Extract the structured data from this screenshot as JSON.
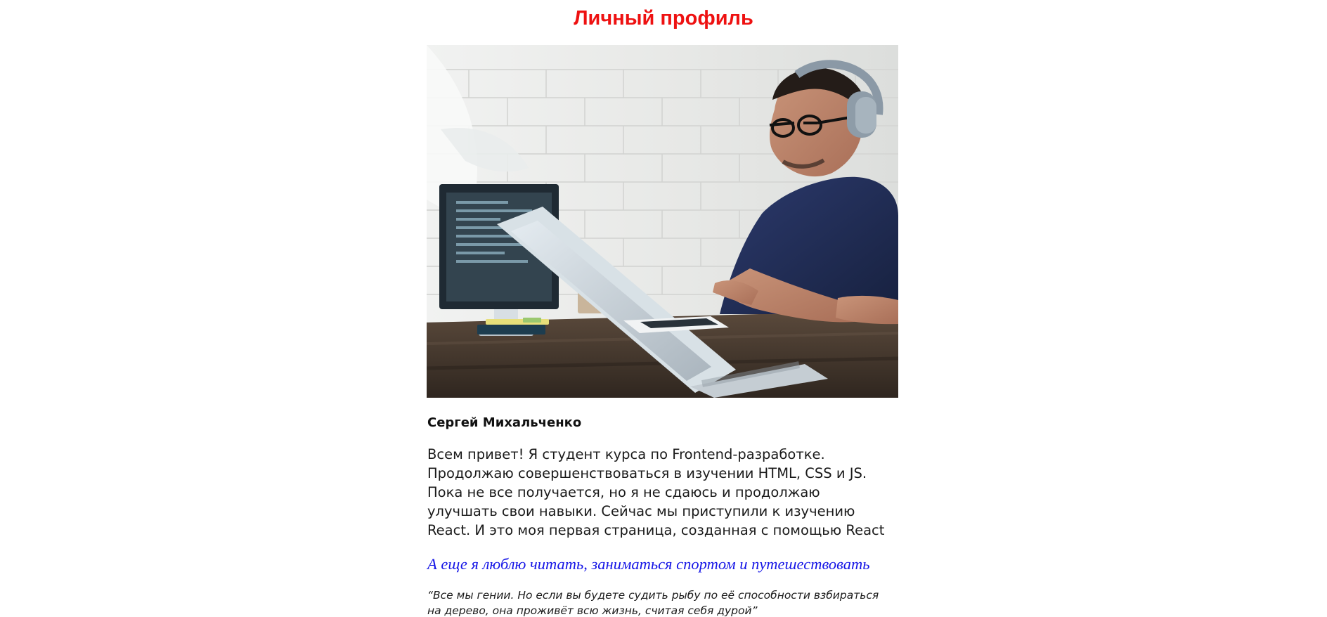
{
  "colors": {
    "title": "#ee1111",
    "hobby": "#1515e6"
  },
  "profile": {
    "title": "Личный профиль",
    "photo_description": "developer-at-computer-photo",
    "name": "Сергей Михальченко",
    "bio": "Всем привет! Я студент курса по Frontend-разработке. Продолжаю совершенствоваться в изучении HTML, CSS и JS. Пока не все получается, но я не сдаюсь и продолжаю улучшать свои навыки. Сейчас мы приступили к изучению React. И это моя первая страница, созданная с помощью React",
    "hobby": "А еще я люблю читать, заниматься спортом и путешествовать",
    "quote": "“Все мы гении. Но если вы будете судить рыбу по её способности взбираться на дерево, она проживёт всю жизнь, считая себя дурой”"
  }
}
